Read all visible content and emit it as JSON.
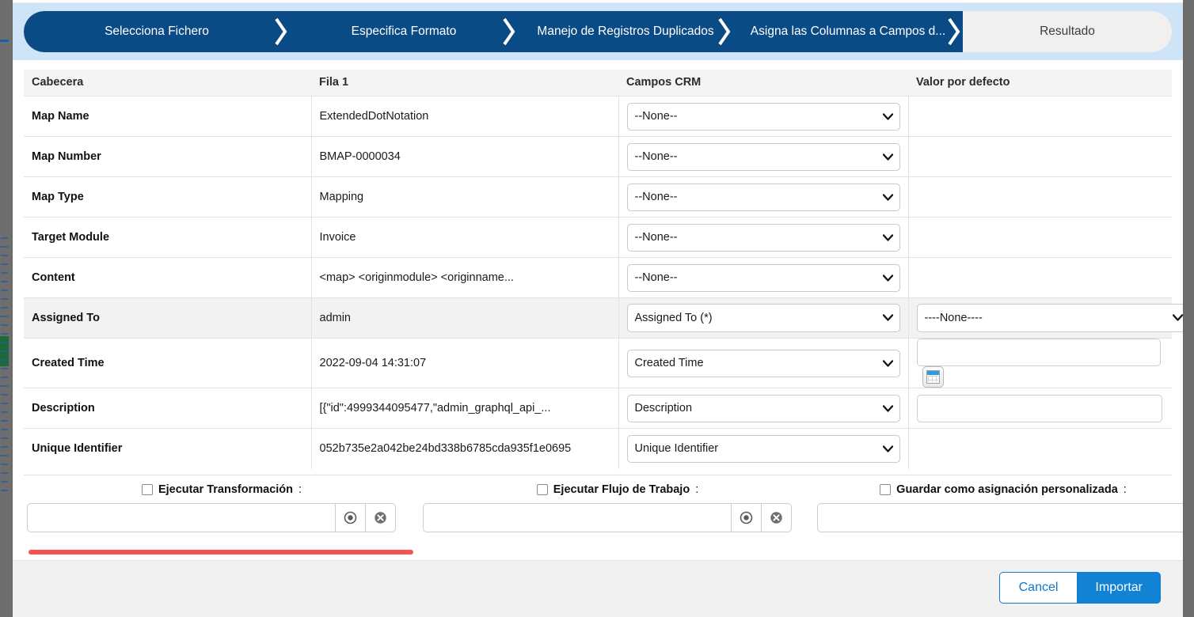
{
  "stepper": {
    "steps": [
      {
        "label": "Selecciona Fichero",
        "state": "done"
      },
      {
        "label": "Especifica Formato",
        "state": "done"
      },
      {
        "label": "Manejo de Registros Duplicados",
        "state": "done"
      },
      {
        "label": "Asigna las Columnas a Campos d...",
        "state": "current"
      },
      {
        "label": "Resultado",
        "state": "pending"
      }
    ],
    "active_color": "#0a4a85",
    "band_color": "#cfe4f7"
  },
  "table": {
    "columns": [
      "Cabecera",
      "Fila 1",
      "Campos CRM",
      "Valor por defecto"
    ],
    "rows": [
      {
        "header": "Map Name",
        "row1": "ExtendedDotNotation",
        "crm": "--None--",
        "default_kind": "none",
        "default_value": ""
      },
      {
        "header": "Map Number",
        "row1": "BMAP-0000034",
        "crm": "--None--",
        "default_kind": "none",
        "default_value": ""
      },
      {
        "header": "Map Type",
        "row1": "Mapping",
        "crm": "--None--",
        "default_kind": "none",
        "default_value": ""
      },
      {
        "header": "Target Module",
        "row1": "Invoice",
        "crm": "--None--",
        "default_kind": "none",
        "default_value": ""
      },
      {
        "header": "Content",
        "row1": "<map> <originmodule> <originname...",
        "crm": "--None--",
        "default_kind": "none",
        "default_value": ""
      },
      {
        "header": "Assigned To",
        "row1": "admin",
        "crm": "Assigned To  (*)",
        "default_kind": "select",
        "default_value": "----None----",
        "highlight": true
      },
      {
        "header": "Created Time",
        "row1": "2022-09-04 14:31:07",
        "crm": "Created Time",
        "default_kind": "calendar",
        "default_value": ""
      },
      {
        "header": "Description",
        "row1": "[{\"id\":4999344095477,\"admin_graphql_api_...",
        "crm": "Description",
        "default_kind": "text",
        "default_value": ""
      },
      {
        "header": "Unique Identifier",
        "row1": "052b735e2a042be24bd338b6785cda935f1e0695",
        "crm": "Unique Identifier",
        "default_kind": "none",
        "default_value": ""
      }
    ]
  },
  "options": {
    "transformation": {
      "label": "Ejecutar Transformación",
      "colon": ":",
      "checked": false,
      "value": "",
      "placeholder": ""
    },
    "workflow": {
      "label": "Ejecutar Flujo de Trabajo",
      "colon": ":",
      "checked": false,
      "value": "",
      "placeholder": ""
    },
    "save_mapping": {
      "label": "Guardar como asignación personalizada",
      "colon": ":",
      "checked": false,
      "value": "",
      "placeholder": ""
    },
    "icons": {
      "select": "target-circle-icon",
      "clear": "clear-circle-icon"
    },
    "underline_color": "#f4544f"
  },
  "footer": {
    "cancel_label": "Cancel",
    "import_label": "Importar",
    "primary_color": "#1282d4"
  }
}
